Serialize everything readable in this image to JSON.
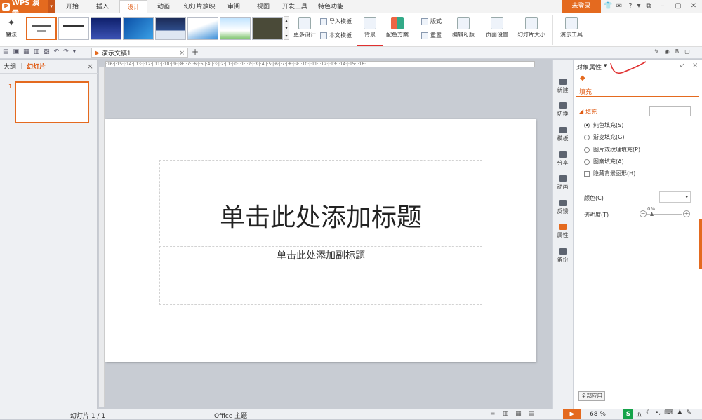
{
  "app": {
    "name": "WPS 演示",
    "logo_glyph": "P"
  },
  "tabs": [
    "开始",
    "插入",
    "设计",
    "动画",
    "幻灯片放映",
    "审阅",
    "视图",
    "开发工具",
    "特色功能"
  ],
  "active_tab": "设计",
  "login_label": "未登录",
  "ribbon": {
    "magic_label": "魔法",
    "more_design_label": "更多设计",
    "import_template_label": "导入模板",
    "this_template_label": "本文模板",
    "background_label": "背景",
    "color_scheme_label": "配色方案",
    "layout_label": "版式",
    "reset_label": "重置",
    "edit_master_label": "编辑母版",
    "page_setup_label": "页面设置",
    "slide_size_label": "幻灯片大小",
    "present_tools_label": "演示工具"
  },
  "document_tab": {
    "name": "演示文稿1",
    "close": "×",
    "add": "+"
  },
  "left_panel": {
    "outline_tab": "大纲",
    "slides_tab": "幻灯片",
    "close": "×",
    "slide_number": "1"
  },
  "ruler_text": "·16·|·15·|·14·|·13·|·12·|·11·|·10·|·9·|·8·|·7·|·6·|·5·|·4·|·3·|·2·|·1·|·0·|·1·|·2·|·3·|·4·|·5·|·6·|·7·|·8·|·9·|·10·|·11·|·12·|·13·|·14·|·15·|·16·",
  "slide": {
    "title_placeholder": "单击此处添加标题",
    "subtitle_placeholder": "单击此处添加副标题"
  },
  "sidebar_items": [
    "新建",
    "切换",
    "模板",
    "分享",
    "动画",
    "反馈",
    "属性",
    "备份"
  ],
  "properties": {
    "header": "对象属性",
    "fill_tab": "填充",
    "section": "填充",
    "options": [
      "纯色填充(S)",
      "渐变填充(G)",
      "图片或纹理填充(P)",
      "图案填充(A)"
    ],
    "hide_bg": "隐藏背景图形(H)",
    "color_label": "颜色(C)",
    "transparency_label": "透明度(T)",
    "transparency_value": "0%",
    "apply_all_label": "全部应用"
  },
  "status": {
    "slide_count": "幻灯片 1 / 1",
    "theme": "Office 主题",
    "zoom": "68 %",
    "ime": "五"
  },
  "colors": {
    "accent": "#e46a1f",
    "canvas": "#c8ccd3"
  }
}
